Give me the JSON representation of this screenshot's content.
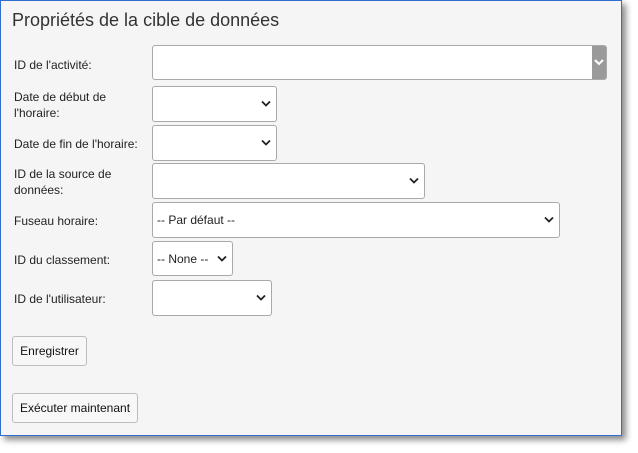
{
  "title": "Propriétés de la cible de données",
  "fields": {
    "activity_id": {
      "label": "ID de l'activité:",
      "value": ""
    },
    "schedule_start": {
      "label": "Date de début de l'horaire:",
      "value": ""
    },
    "schedule_end": {
      "label": "Date de fin de l'horaire:",
      "value": ""
    },
    "datasource_id": {
      "label": "ID de la source de données:",
      "value": ""
    },
    "timezone": {
      "label": "Fuseau horaire:",
      "value": "-- Par défaut --"
    },
    "ranking_id": {
      "label": "ID du classement:",
      "value": "-- None --"
    },
    "user_id": {
      "label": "ID de l'utilisateur:",
      "value": ""
    }
  },
  "buttons": {
    "save": "Enregistrer",
    "run_now": "Exécuter maintenant"
  },
  "icons": {
    "dropdown": "chevron-down-icon"
  },
  "colors": {
    "panel_border": "#2f6fd0",
    "panel_background": "#f5f5f5"
  }
}
